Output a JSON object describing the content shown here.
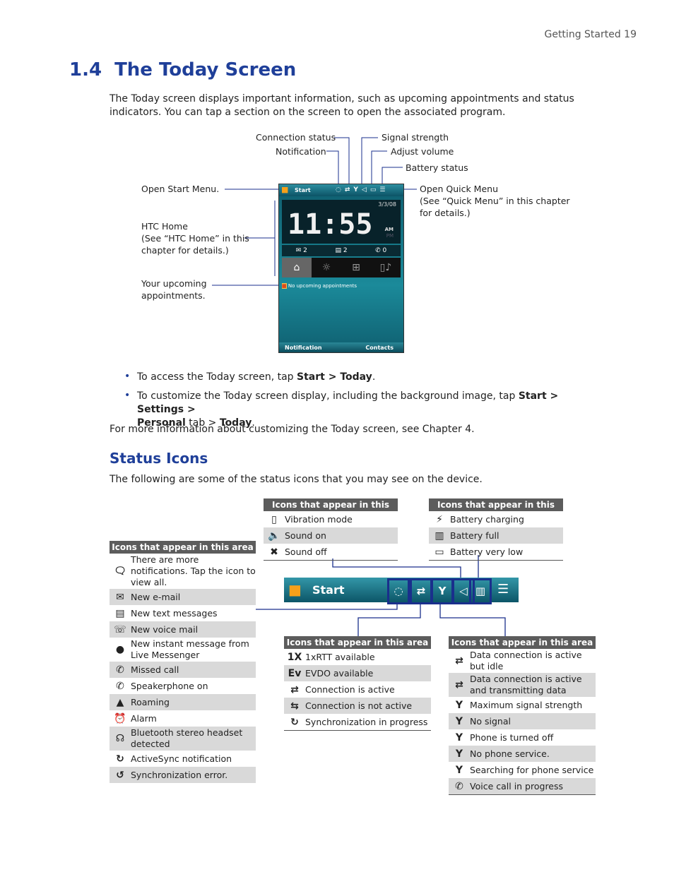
{
  "header": {
    "running": "Getting Started  19"
  },
  "section": {
    "number": "1.4",
    "title": "The Today Screen"
  },
  "intro": "The Today screen displays important information, such as upcoming appointments and status indicators. You can tap a section on the screen to open the associated program.",
  "callouts": {
    "connection_status": "Connection status",
    "notification": "Notification",
    "signal_strength": "Signal strength",
    "adjust_volume": "Adjust volume",
    "battery_status": "Battery status",
    "open_start": "Open Start Menu.",
    "open_quick": "Open Quick Menu",
    "open_quick_2": "(See “Quick Menu” in this chapter",
    "open_quick_3": "for details.)",
    "htc_home": "HTC Home",
    "htc_home_2": "(See “HTC Home” in this",
    "htc_home_3": "chapter for details.)",
    "appointments": "Your upcoming",
    "appointments_2": "appointments."
  },
  "phone": {
    "start": "Start",
    "date": "3/3/08",
    "time": "11:55",
    "am": "AM",
    "pm": "PM",
    "email_count": "2",
    "sms_count": "2",
    "missed_count": "0",
    "appointments": "No upcoming appointments",
    "softkey_left": "Notification",
    "softkey_right": "Contacts"
  },
  "bullets": [
    {
      "pre": "To access the Today screen, tap ",
      "b1": "Start > Today",
      "post": "."
    },
    {
      "pre": "To customize the Today screen display, including the background image, tap ",
      "b1": "Start > Settings >",
      "line2b": "Personal",
      "mid": " tab > ",
      "b2": "Today",
      "post": "."
    }
  ],
  "more_info": "For more information about customizing the Today screen, see Chapter 4.",
  "status": {
    "title": "Status Icons",
    "intro": "The following are some of the status icons that you may see on the device."
  },
  "taskbar": {
    "start": "Start"
  },
  "tables": {
    "left": {
      "header": "Icons that appear in this area",
      "rows": [
        {
          "icon": "notification-icon",
          "glyph": "🗨",
          "text": "There are more notifications. Tap the icon to view all."
        },
        {
          "icon": "email-icon",
          "glyph": "✉",
          "text": "New e-mail"
        },
        {
          "icon": "text-message-icon",
          "glyph": "▤",
          "text": "New text messages"
        },
        {
          "icon": "voicemail-icon",
          "glyph": "☏",
          "text": "New voice mail"
        },
        {
          "icon": "messenger-icon",
          "glyph": "●",
          "text": "New instant message from Live Messenger"
        },
        {
          "icon": "missed-call-icon",
          "glyph": "✆",
          "text": "Missed call"
        },
        {
          "icon": "speakerphone-icon",
          "glyph": "✆",
          "text": "Speakerphone on"
        },
        {
          "icon": "roaming-icon",
          "glyph": "▲",
          "text": "Roaming"
        },
        {
          "icon": "alarm-icon",
          "glyph": "⏰",
          "text": "Alarm"
        },
        {
          "icon": "headset-icon",
          "glyph": "☊",
          "text": "Bluetooth stereo headset detected"
        },
        {
          "icon": "activesync-icon",
          "glyph": "↻",
          "text": "ActiveSync notification"
        },
        {
          "icon": "sync-error-icon",
          "glyph": "↺",
          "text": "Synchronization error."
        }
      ]
    },
    "mid_top": {
      "header": "Icons that appear in this area",
      "rows": [
        {
          "icon": "vibration-icon",
          "glyph": "▯",
          "text": "Vibration mode"
        },
        {
          "icon": "sound-on-icon",
          "glyph": "🔈",
          "text": "Sound on"
        },
        {
          "icon": "sound-off-icon",
          "glyph": "✖",
          "text": "Sound off"
        }
      ]
    },
    "right_top": {
      "header": "Icons that appear in this area",
      "rows": [
        {
          "icon": "battery-charging-icon",
          "glyph": "⚡",
          "text": "Battery charging"
        },
        {
          "icon": "battery-full-icon",
          "glyph": "▥",
          "text": "Battery full"
        },
        {
          "icon": "battery-low-icon",
          "glyph": "▭",
          "text": "Battery very low"
        }
      ]
    },
    "mid_bottom": {
      "header": "Icons that appear in this area",
      "rows": [
        {
          "icon": "1xrtt-icon",
          "glyph": "1X",
          "text": "1xRTT available"
        },
        {
          "icon": "evdo-icon",
          "glyph": "Ev",
          "text": "EVDO available"
        },
        {
          "icon": "connection-active-icon",
          "glyph": "⇄",
          "text": "Connection is active"
        },
        {
          "icon": "connection-inactive-icon",
          "glyph": "⇆",
          "text": "Connection is not active"
        },
        {
          "icon": "sync-progress-icon",
          "glyph": "↻",
          "text": "Synchronization in progress"
        }
      ]
    },
    "right_bottom": {
      "header": "Icons that appear in this area",
      "rows": [
        {
          "icon": "data-idle-icon",
          "glyph": "⇄",
          "text": "Data connection is active but idle"
        },
        {
          "icon": "data-transmitting-icon",
          "glyph": "⇄",
          "text": "Data connection is active and transmitting data"
        },
        {
          "icon": "signal-max-icon",
          "glyph": "Y",
          "text": "Maximum signal strength"
        },
        {
          "icon": "no-signal-icon",
          "glyph": "Y",
          "text": "No signal"
        },
        {
          "icon": "phone-off-icon",
          "glyph": "Y",
          "text": "Phone is turned off"
        },
        {
          "icon": "no-service-icon",
          "glyph": "Y",
          "text": "No phone service."
        },
        {
          "icon": "searching-icon",
          "glyph": "Y",
          "text": "Searching for phone service"
        },
        {
          "icon": "voice-call-icon",
          "glyph": "✆",
          "text": "Voice call in progress"
        }
      ]
    }
  },
  "colors": {
    "heading": "#1f3f99",
    "table_header": "#5c5c5c",
    "row_shade": "#d9d9d9",
    "callout_line": "#1a2f8c"
  }
}
